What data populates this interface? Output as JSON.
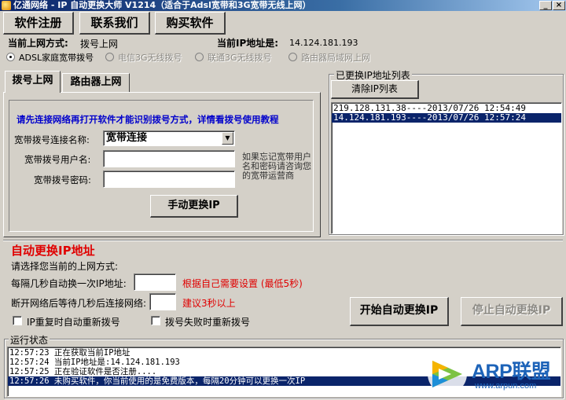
{
  "window": {
    "title": "亿通网络 - IP 自动更换大师 V1214（适合于Adsl宽带和3G宽带无线上网）",
    "minimize": "_",
    "close": "×"
  },
  "toolbar": {
    "register": "软件注册",
    "contact": "联系我们",
    "buy": "购买软件"
  },
  "status": {
    "mode_label": "当前上网方式:",
    "mode_value": "拨号上网",
    "ip_label": "当前IP地址是:",
    "ip_value": "14.124.181.193"
  },
  "connection_modes": [
    {
      "label": "ADSL家庭宽带拨号",
      "selected": true,
      "enabled": true
    },
    {
      "label": "电信3G无线拨号",
      "selected": false,
      "enabled": false
    },
    {
      "label": "联通3G无线拨号",
      "selected": false,
      "enabled": false
    },
    {
      "label": "路由器局域网上网",
      "selected": false,
      "enabled": false
    }
  ],
  "tabs": {
    "dialup": "拨号上网",
    "router": "路由器上网"
  },
  "dialup": {
    "notice": "请先连接网络再打开软件才能识别拨号方式，详情看拨号使用教程",
    "conn_name_label": "宽带拨号连接名称:",
    "conn_name_value": "宽带连接",
    "user_label": "宽带拨号用户名:",
    "user_value": "",
    "pass_label": "宽带拨号密码:",
    "pass_value": "",
    "hint": "如果忘记宽带用户名和密码请咨询您的宽带运营商",
    "change_button": "手动更换IP"
  },
  "ip_history": {
    "title": "已更换IP地址列表",
    "clear_button": "清除IP列表",
    "entries": [
      "219.128.131.38----2013/07/26 12:54:49",
      "14.124.181.193----2013/07/26 12:57:24"
    ]
  },
  "auto": {
    "title": "自动更换IP地址",
    "choose_label": "请选择您当前的上网方式:",
    "interval_label": "每隔几秒自动换一次IP地址:",
    "interval_value": "",
    "interval_hint": "根据自己需要设置 (最低5秒)",
    "reconnect_label": "断开网络后等待几秒后连接网络:",
    "reconnect_value": "",
    "reconnect_hint": "建议3秒以上",
    "repeat_redial": "IP重复时自动重新拨号",
    "fail_redial": "拨号失败时重新拨号",
    "start_button": "开始自动更换IP",
    "stop_button": "停止自动更换IP"
  },
  "log": {
    "title": "运行状态",
    "entries": [
      "12:57:23 正在获取当前IP地址",
      "12:57:24 当前IP地址是:14.124.181.193",
      "12:57:25 正在验证软件是否注册....",
      "12:57:26 未购买软件，你当前使用的是免费版本，每隔20分钟可以更换一次IP"
    ]
  },
  "watermark": {
    "brand": "ARP联盟",
    "url": "www.arpun.com"
  },
  "colors": {
    "titlebar": "#0a246a",
    "selection": "#0a246a",
    "red_title": "#e00000",
    "notice_blue": "#0000cc",
    "watermark_blue": "#1d63b8"
  }
}
